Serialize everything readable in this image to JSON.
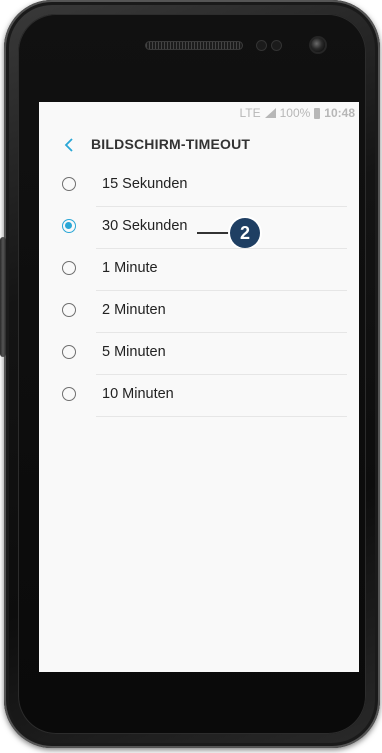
{
  "status_bar": {
    "network": "LTE",
    "battery": "100%",
    "time": "10:48"
  },
  "header": {
    "title": "BILDSCHIRM-TIMEOUT",
    "back_icon": "chevron-left-icon"
  },
  "options": [
    {
      "label": "15 Sekunden",
      "selected": false
    },
    {
      "label": "30 Sekunden",
      "selected": true
    },
    {
      "label": "1 Minute",
      "selected": false
    },
    {
      "label": "2 Minuten",
      "selected": false
    },
    {
      "label": "5 Minuten",
      "selected": false
    },
    {
      "label": "10 Minuten",
      "selected": false
    }
  ],
  "callout": {
    "number": "2",
    "color": "#1f3f63"
  },
  "colors": {
    "accent": "#2aa7d6"
  }
}
